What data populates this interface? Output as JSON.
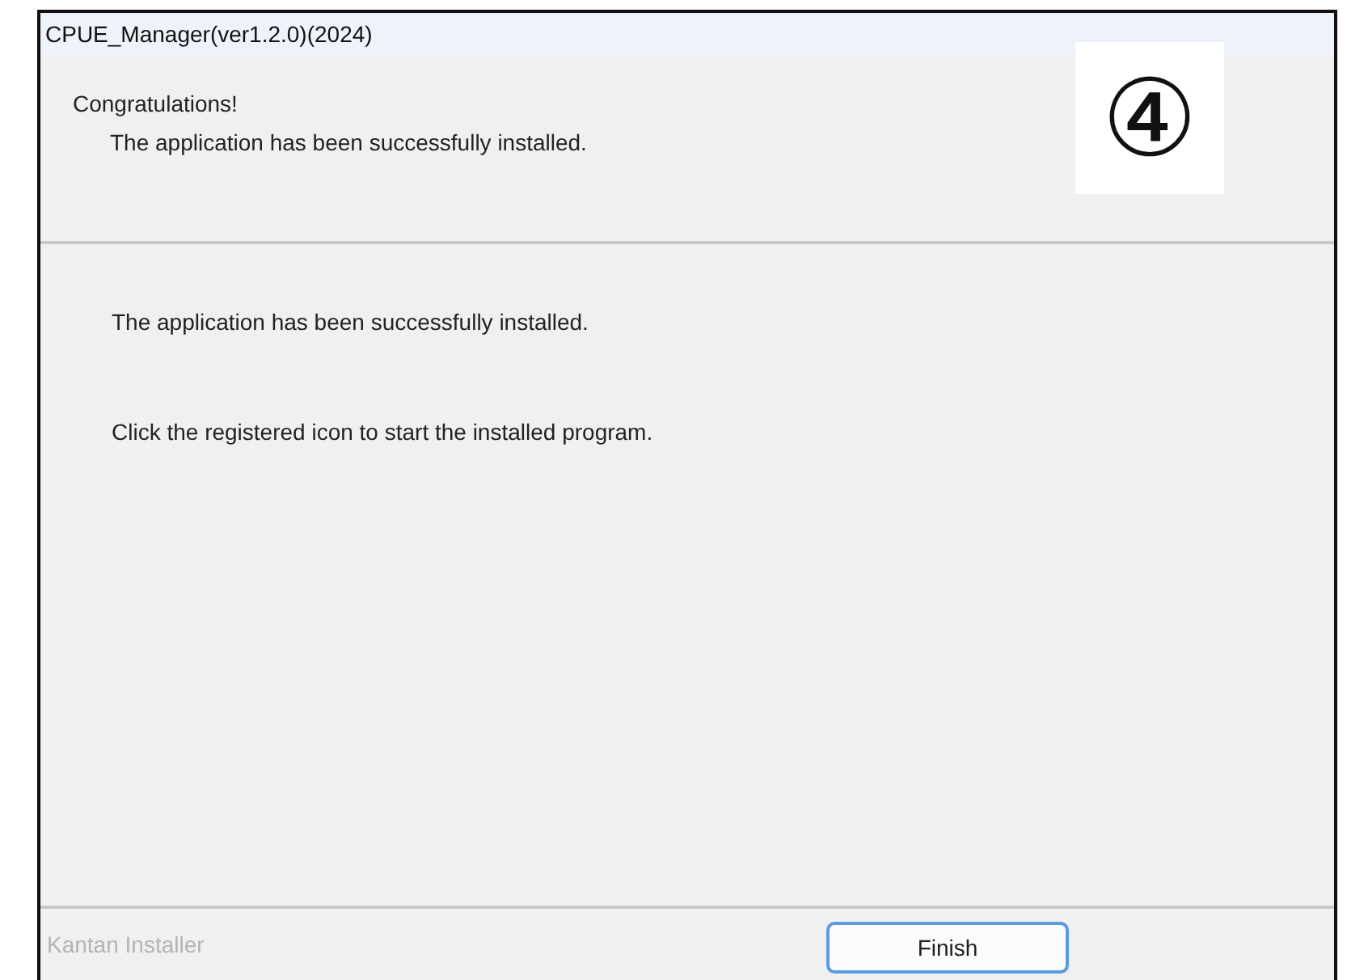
{
  "window": {
    "title": "CPUE_Manager(ver1.2.0)(2024)"
  },
  "header": {
    "title": "Congratulations!",
    "subtitle": "The application has been successfully installed.",
    "step_marker": "④"
  },
  "body": {
    "lines": [
      "The application has been successfully installed.",
      "Click the registered icon to start the installed program."
    ]
  },
  "footer": {
    "brand": "Kantan Installer",
    "buttons": [
      {
        "label": "Finish"
      }
    ]
  }
}
